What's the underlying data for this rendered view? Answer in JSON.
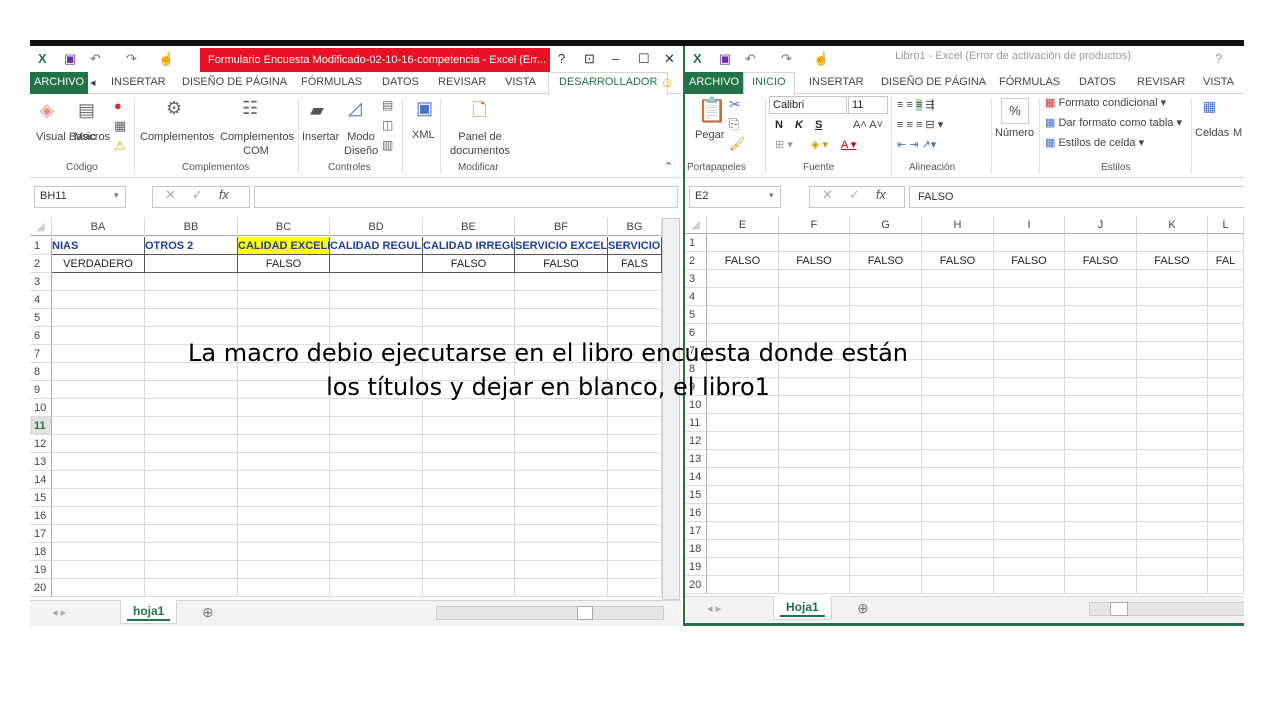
{
  "left_window": {
    "title": "Formulario Encuesta Modificado-02-10-16-competencia -  Excel (Err...",
    "tabs": [
      "ARCHIVO",
      "INSERTAR",
      "DISEÑO DE PÁGINA",
      "FÓRMULAS",
      "DATOS",
      "REVISAR",
      "VISTA",
      "DESARROLLADOR"
    ],
    "ribbon": {
      "visual_basic": "Visual Basic",
      "macros": "Macros",
      "complementos": "Complementos",
      "complementos_com": "Complementos COM",
      "insertar": "Insertar",
      "modo_diseno": "Modo Diseño",
      "xml": "XML",
      "panel": "Panel de documentos",
      "groups": [
        "Código",
        "Complementos",
        "Controles",
        "Modificar"
      ]
    },
    "name_box": "BH11",
    "formula": "",
    "columns": [
      "BA",
      "BB",
      "BC",
      "BD",
      "BE",
      "BF",
      "BG"
    ],
    "row1": [
      "NIAS",
      "OTROS 2",
      "CALIDAD EXCELE",
      "CALIDAD REGUL",
      "CALIDAD IRREGU",
      "SERVICIO EXCEL",
      "SERVICIO"
    ],
    "row2": [
      "VERDADERO",
      "",
      "FALSO",
      "",
      "FALSO",
      "FALSO",
      "FALS"
    ],
    "highlight_color": "#ffff00",
    "header_text_color": "#1f3d99",
    "selected_row": 11,
    "sheet_tab": "hoja1"
  },
  "right_window": {
    "title": "Libro1 - Excel (Error de activación de productos)",
    "tabs": [
      "ARCHIVO",
      "INICIO",
      "INSERTAR",
      "DISEÑO DE PÁGINA",
      "FÓRMULAS",
      "DATOS",
      "REVISAR",
      "VISTA"
    ],
    "ribbon": {
      "pegar": "Pegar",
      "font": "Calibri",
      "size": "11",
      "bold": "N",
      "italic": "K",
      "underline": "S",
      "numero": "Número",
      "formato_condicional": "Formato condicional",
      "dar_formato": "Dar formato como tabla",
      "estilos_celda": "Estilos de celda",
      "celdas": "Celdas",
      "m": "M",
      "groups": [
        "Portapapeles",
        "Fuente",
        "Alineación",
        "Estilos"
      ]
    },
    "name_box": "E2",
    "formula": "FALSO",
    "columns": [
      "E",
      "F",
      "G",
      "H",
      "I",
      "J",
      "K",
      "L"
    ],
    "row1": [
      "",
      "",
      "",
      "",
      "",
      "",
      "",
      ""
    ],
    "row2": [
      "FALSO",
      "FALSO",
      "FALSO",
      "FALSO",
      "FALSO",
      "FALSO",
      "FALSO",
      "FAL"
    ],
    "sheet_tab": "Hoja1"
  },
  "rows": [
    1,
    2,
    3,
    4,
    5,
    6,
    7,
    8,
    9,
    10,
    11,
    12,
    13,
    14,
    15,
    16,
    17,
    18,
    19,
    20
  ],
  "overlay": {
    "line1": "La macro debio ejecutarse en el libro encuesta donde están",
    "line2": "los títulos y dejar en blanco, el libro1"
  },
  "accent": "#217346"
}
